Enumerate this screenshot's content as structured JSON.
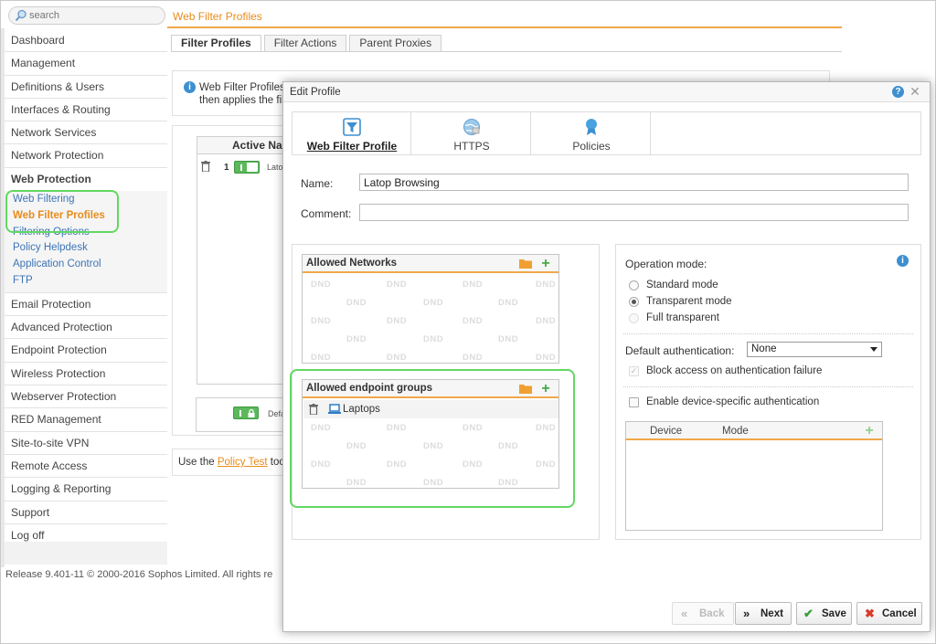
{
  "app": {
    "search_placeholder": "search",
    "breadcrumb": "Web Filter Profiles",
    "release": "Release 9.401-11  © 2000-2016 Sophos Limited. All rights re",
    "tabs": [
      "Filter Profiles",
      "Filter Actions",
      "Parent Proxies"
    ],
    "info_text_line1": "Web Filter Profiles",
    "info_text_line2": "then applies the fil",
    "list_header": "Active  Na",
    "row_number": "1",
    "row_name": "Latop",
    "default_name": "Defa",
    "policy_text_prefix": "Use the ",
    "policy_link": "Policy Test",
    "policy_text_suffix": " too"
  },
  "sidebar": {
    "items": [
      "Dashboard",
      "Management",
      "Definitions & Users",
      "Interfaces & Routing",
      "Network Services",
      "Network Protection",
      "Web Protection"
    ],
    "web_protection_subitems": [
      "Web Filtering",
      "Web Filter Profiles",
      "Filtering Options",
      "Policy Helpdesk",
      "Application Control",
      "FTP"
    ],
    "items_after": [
      "Email Protection",
      "Advanced Protection",
      "Endpoint Protection",
      "Wireless Protection",
      "Webserver Protection",
      "RED Management",
      "Site-to-site VPN",
      "Remote Access",
      "Logging & Reporting",
      "Support",
      "Log off"
    ]
  },
  "dialog": {
    "title": "Edit Profile",
    "tabs": [
      "Web Filter Profile",
      "HTTPS",
      "Policies"
    ],
    "name_label": "Name:",
    "name_value": "Latop Browsing",
    "comment_label": "Comment:",
    "comment_value": "",
    "allowed_networks_title": "Allowed Networks",
    "allowed_endpoint_groups_title": "Allowed endpoint groups",
    "endpoint_item": "Laptops",
    "dnd_watermark": "DND",
    "operation_mode_label": "Operation mode:",
    "operation_modes": [
      "Standard mode",
      "Transparent mode",
      "Full transparent"
    ],
    "operation_mode_selected": "Transparent mode",
    "default_auth_label": "Default authentication:",
    "default_auth_value": "None",
    "block_access_label": "Block access on authentication failure",
    "device_auth_label": "Enable device-specific authentication",
    "device_table_headers": [
      "Device",
      "Mode"
    ],
    "buttons": {
      "back": "Back",
      "next": "Next",
      "save": "Save",
      "cancel": "Cancel"
    }
  },
  "colors": {
    "accent_orange": "#e88b1a",
    "highlight_green": "#62d862",
    "toggle_green": "#5cb85c",
    "info_blue": "#3d8fd0"
  }
}
